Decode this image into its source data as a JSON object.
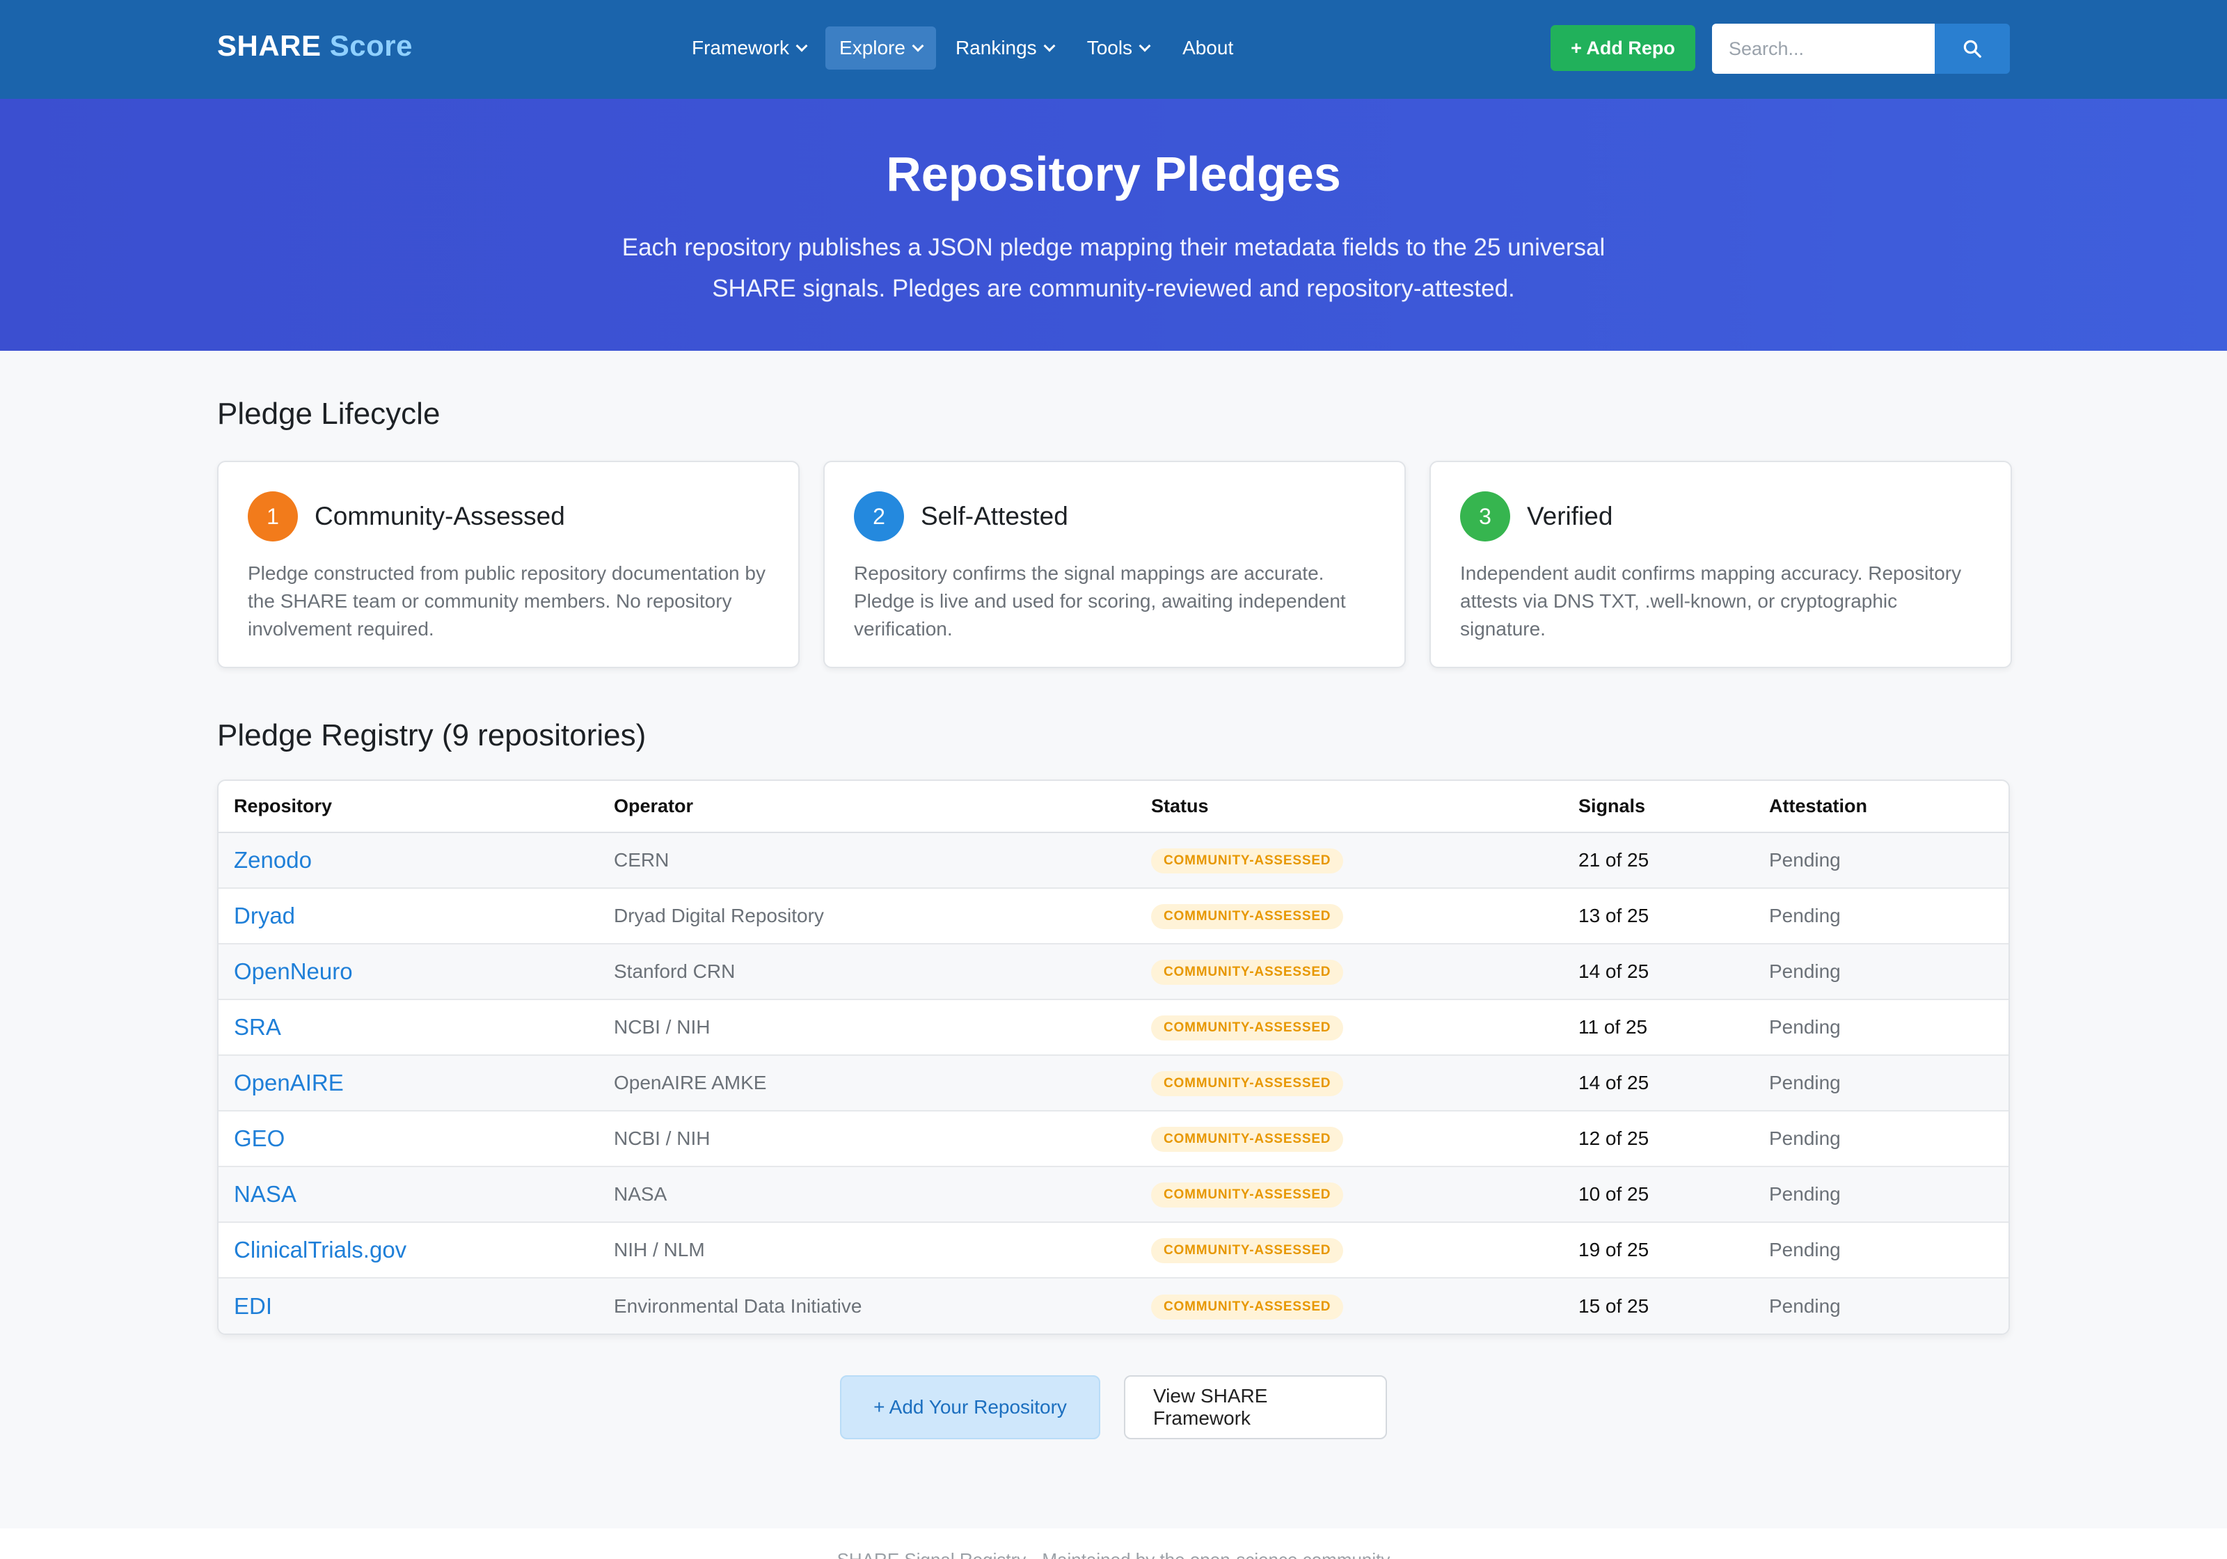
{
  "brand": {
    "name": "SHARE",
    "accent": "Score"
  },
  "nav": [
    {
      "label": "Framework",
      "dropdown": true,
      "active": false
    },
    {
      "label": "Explore",
      "dropdown": true,
      "active": true
    },
    {
      "label": "Rankings",
      "dropdown": true,
      "active": false
    },
    {
      "label": "Tools",
      "dropdown": true,
      "active": false
    },
    {
      "label": "About",
      "dropdown": false,
      "active": false
    }
  ],
  "header": {
    "add_repo_label": "+ Add Repo",
    "search_placeholder": "Search...",
    "search_icon": "search-icon"
  },
  "hero": {
    "title": "Repository Pledges",
    "subtitle": "Each repository publishes a JSON pledge mapping their metadata fields to the 25 universal SHARE signals. Pledges are community-reviewed and repository-attested."
  },
  "lifecycle": {
    "title": "Pledge Lifecycle",
    "steps": [
      {
        "number": "1",
        "title": "Community-Assessed",
        "color": "#f27b1b",
        "description": "Pledge constructed from public repository documentation by the SHARE team or community members. No repository involvement required."
      },
      {
        "number": "2",
        "title": "Self-Attested",
        "color": "#2489de",
        "description": "Repository confirms the signal mappings are accurate. Pledge is live and used for scoring, awaiting independent verification."
      },
      {
        "number": "3",
        "title": "Verified",
        "color": "#36b54f",
        "description": "Independent audit confirms mapping accuracy. Repository attests via DNS TXT, .well-known, or cryptographic signature."
      }
    ]
  },
  "registry": {
    "title": "Pledge Registry (9 repositories)",
    "columns": [
      "Repository",
      "Operator",
      "Status",
      "Signals",
      "Attestation"
    ],
    "rows": [
      {
        "repository": "Zenodo",
        "operator": "CERN",
        "status": "COMMUNITY-ASSESSED",
        "signals": "21 of 25",
        "attestation": "Pending"
      },
      {
        "repository": "Dryad",
        "operator": "Dryad Digital Repository",
        "status": "COMMUNITY-ASSESSED",
        "signals": "13 of 25",
        "attestation": "Pending"
      },
      {
        "repository": "OpenNeuro",
        "operator": "Stanford CRN",
        "status": "COMMUNITY-ASSESSED",
        "signals": "14 of 25",
        "attestation": "Pending"
      },
      {
        "repository": "SRA",
        "operator": "NCBI / NIH",
        "status": "COMMUNITY-ASSESSED",
        "signals": "11 of 25",
        "attestation": "Pending"
      },
      {
        "repository": "OpenAIRE",
        "operator": "OpenAIRE AMKE",
        "status": "COMMUNITY-ASSESSED",
        "signals": "14 of 25",
        "attestation": "Pending"
      },
      {
        "repository": "GEO",
        "operator": "NCBI / NIH",
        "status": "COMMUNITY-ASSESSED",
        "signals": "12 of 25",
        "attestation": "Pending"
      },
      {
        "repository": "NASA",
        "operator": "NASA",
        "status": "COMMUNITY-ASSESSED",
        "signals": "10 of 25",
        "attestation": "Pending"
      },
      {
        "repository": "ClinicalTrials.gov",
        "operator": "NIH / NLM",
        "status": "COMMUNITY-ASSESSED",
        "signals": "19 of 25",
        "attestation": "Pending"
      },
      {
        "repository": "EDI",
        "operator": "Environmental Data Initiative",
        "status": "COMMUNITY-ASSESSED",
        "signals": "15 of 25",
        "attestation": "Pending"
      }
    ]
  },
  "actions": {
    "primary_label": "+ Add Your Repository",
    "secondary_label": "View SHARE Framework"
  },
  "footer": {
    "text": "SHARE Signal Registry · Maintained by the open-science community"
  },
  "colors": {
    "navbar": "#1b64ac",
    "hero": "#3c55d6",
    "add_repo": "#21b15b",
    "link": "#1f7fd8",
    "badge_text": "#e79700",
    "badge_bg": "#fff3d8"
  }
}
